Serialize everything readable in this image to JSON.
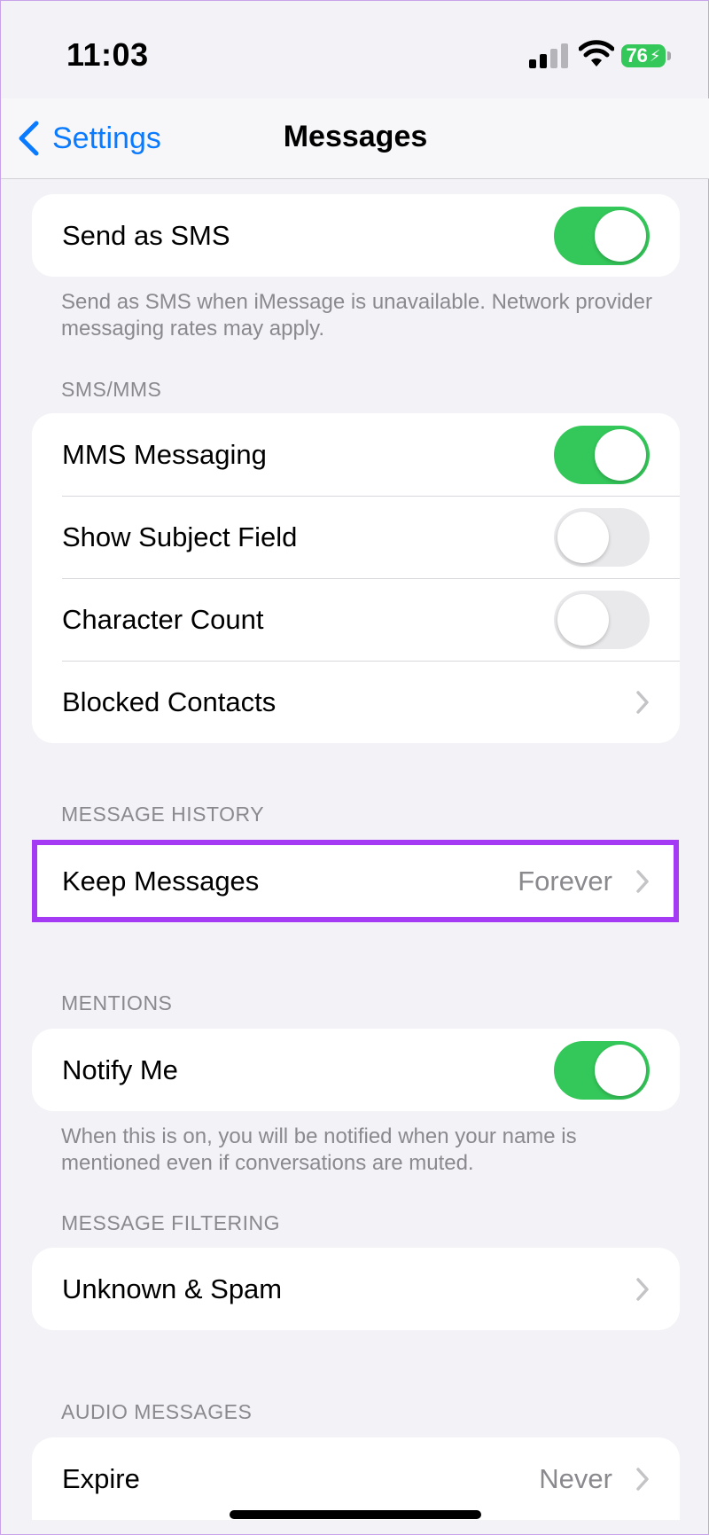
{
  "status_bar": {
    "time": "11:03",
    "battery": "76"
  },
  "nav": {
    "back_label": "Settings",
    "title": "Messages"
  },
  "send_as_sms": {
    "label": "Send as SMS",
    "enabled": true,
    "footnote": "Send as SMS when iMessage is unavailable. Network provider messaging rates may apply."
  },
  "sms_mms": {
    "header": "SMS/MMS",
    "rows": [
      {
        "label": "MMS Messaging",
        "type": "toggle",
        "enabled": true
      },
      {
        "label": "Show Subject Field",
        "type": "toggle",
        "enabled": false
      },
      {
        "label": "Character Count",
        "type": "toggle",
        "enabled": false
      },
      {
        "label": "Blocked Contacts",
        "type": "link"
      }
    ]
  },
  "message_history": {
    "header": "MESSAGE HISTORY",
    "keep_messages": {
      "label": "Keep Messages",
      "value": "Forever"
    }
  },
  "mentions": {
    "header": "MENTIONS",
    "notify_me": {
      "label": "Notify Me",
      "enabled": true
    },
    "footnote": "When this is on, you will be notified when your name is mentioned even if conversations are muted."
  },
  "message_filtering": {
    "header": "MESSAGE FILTERING",
    "unknown_spam": {
      "label": "Unknown & Spam"
    }
  },
  "audio_messages": {
    "header": "AUDIO MESSAGES",
    "expire": {
      "label": "Expire",
      "value": "Never"
    }
  },
  "colors": {
    "accent": "#0a7aff",
    "toggle_on": "#34c759",
    "highlight": "#a43af3"
  }
}
